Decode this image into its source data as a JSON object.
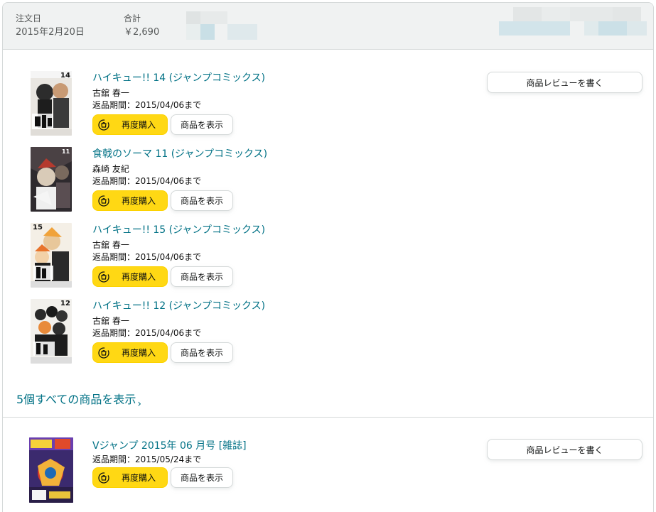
{
  "order": {
    "date_label": "注文日",
    "date_value": "2015年2月20日",
    "total_label": "合計",
    "total_value": "￥2,690"
  },
  "items": [
    {
      "title": "ハイキュー!! 14 (ジャンプコミックス)",
      "author": "古舘 春一",
      "return_policy": "返品期間：2015/04/06まで",
      "rebuy_label": "再度購入",
      "view_label": "商品を表示",
      "cover_number": "14"
    },
    {
      "title": "食戟のソーマ 11 (ジャンプコミックス)",
      "author": "森崎 友紀",
      "return_policy": "返品期間：2015/04/06まで",
      "rebuy_label": "再度購入",
      "view_label": "商品を表示",
      "cover_number": "11"
    },
    {
      "title": "ハイキュー!! 15 (ジャンプコミックス)",
      "author": "古舘 春一",
      "return_policy": "返品期間：2015/04/06まで",
      "rebuy_label": "再度購入",
      "view_label": "商品を表示",
      "cover_number": "15"
    },
    {
      "title": "ハイキュー!! 12 (ジャンプコミックス)",
      "author": "古舘 春一",
      "return_policy": "返品期間：2015/04/06まで",
      "rebuy_label": "再度購入",
      "view_label": "商品を表示",
      "cover_number": "12"
    },
    {
      "title": "Vジャンプ 2015年 06 月号 [雑誌]",
      "return_policy": "返品期間：2015/05/24まで",
      "rebuy_label": "再度購入",
      "view_label": "商品を表示"
    }
  ],
  "review_label": "商品レビューを書く",
  "show_all_label": "5個すべての商品を表示",
  "colors": {
    "link": "#007185",
    "rebuy_button": "#ffd814",
    "header_bg": "#f0f2f2",
    "border": "#d5d9d9"
  },
  "icons": {
    "rebuy": "rebuy-cycle-icon",
    "chevron": "chevron-right-icon"
  }
}
